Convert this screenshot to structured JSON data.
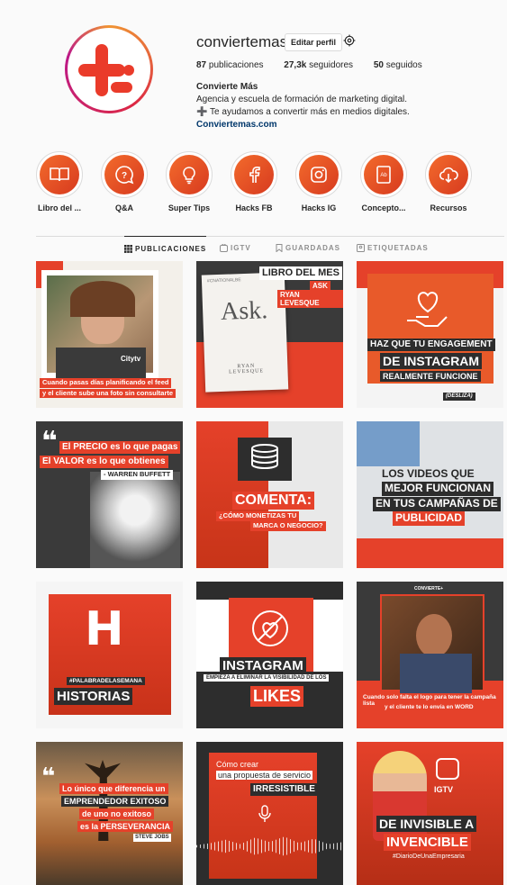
{
  "profile": {
    "username": "conviertemas",
    "edit_button": "Editar perfil",
    "stats": {
      "posts_count": "87",
      "posts_label": "publicaciones",
      "followers_count": "27,3k",
      "followers_label": "seguidores",
      "following_count": "50",
      "following_label": "seguidos"
    },
    "bio": {
      "name": "Convierte Más",
      "line1": "Agencia y escuela de formación de marketing digital.",
      "line2": "➕ Te ayudamos a convertir más en medios digitales.",
      "link": "Conviertemas.com"
    }
  },
  "highlights": [
    {
      "label": "Libro del ...",
      "icon": "book-icon"
    },
    {
      "label": "Q&A",
      "icon": "question-bubble-icon"
    },
    {
      "label": "Super Tips",
      "icon": "lightbulb-icon"
    },
    {
      "label": "Hacks FB",
      "icon": "facebook-icon"
    },
    {
      "label": "Hacks IG",
      "icon": "instagram-icon"
    },
    {
      "label": "Concepto...",
      "icon": "adobe-file-icon"
    },
    {
      "label": "Recursos",
      "icon": "cloud-download-icon"
    }
  ],
  "tabs": [
    {
      "label": "PUBLICACIONES",
      "icon": "grid-icon",
      "active": true
    },
    {
      "label": "IGTV",
      "icon": "igtv-icon",
      "active": false
    },
    {
      "label": "GUARDADAS",
      "icon": "bookmark-icon",
      "active": false
    },
    {
      "label": "ETIQUETADAS",
      "icon": "tag-icon",
      "active": false
    }
  ],
  "posts": {
    "p1": {
      "line1": "Cuando pasas días planificando el feed",
      "line2": "y el cliente sube una foto sin consultarte",
      "watermark": "Citytv"
    },
    "p2": {
      "tag": "#CNATIONALBE",
      "title": "LIBRO DEL MES",
      "sub1": "ASK",
      "sub2": "RYAN LEVESQUE",
      "book_title": "Ask.",
      "book_author1": "RYAN",
      "book_author2": "LEVESQUE"
    },
    "p3": {
      "line1": "HAZ QUE TU ENGAGEMENT",
      "line2": "DE INSTAGRAM",
      "line3": "REALMENTE FUNCIONE",
      "tag": "(DESLIZA)"
    },
    "p4": {
      "l1a": "El ",
      "l1b": "PRECIO",
      "l1c": " es lo que pagas",
      "l2a": "El ",
      "l2b": "VALOR",
      "l2c": " es lo que obtienes",
      "author": "- WARREN BUFFETT"
    },
    "p5": {
      "title": "COMENTA:",
      "sub1": "¿CÓMO MONETIZAS TU",
      "sub2": "MARCA O NEGOCIO?"
    },
    "p6": {
      "line1": "LOS VIDEOS QUE",
      "line2": "MEJOR FUNCIONAN",
      "line3": "EN TUS CAMPAÑAS DE",
      "line4": "PUBLICIDAD"
    },
    "p7": {
      "letter": "H",
      "hashtag": "#PALABRADELASEMANA",
      "word": "HISTORIAS"
    },
    "p8": {
      "title": "INSTAGRAM",
      "sub": "EMPIEZA A ELIMINAR LA VISIBILIDAD DE LOS",
      "word": "LIKES"
    },
    "p9": {
      "brand": "CONVIERTE+",
      "line1": "Cuando solo falta el logo para tener la campaña lista",
      "line2": "y el cliente te lo envía en WORD"
    },
    "p10": {
      "l1": "Lo único que diferencia un",
      "l2": "EMPRENDEDOR EXITOSO",
      "l3": "de uno no exitoso",
      "l4a": "es la ",
      "l4b": "PERSEVERANCIA",
      "author": "STEVE JOBS"
    },
    "p11": {
      "l1": "Cómo crear",
      "l2": "una propuesta de servicio",
      "l3": "IRRESISTIBLE"
    },
    "p12": {
      "badge": "IGTV",
      "l1": "DE INVISIBLE A",
      "l2": "INVENCIBLE",
      "hashtag": "#DiarioDeUnaEmpresaria"
    }
  },
  "colors": {
    "accent": "#e5412a",
    "dark": "#2d2d2d",
    "link": "#00376b"
  }
}
